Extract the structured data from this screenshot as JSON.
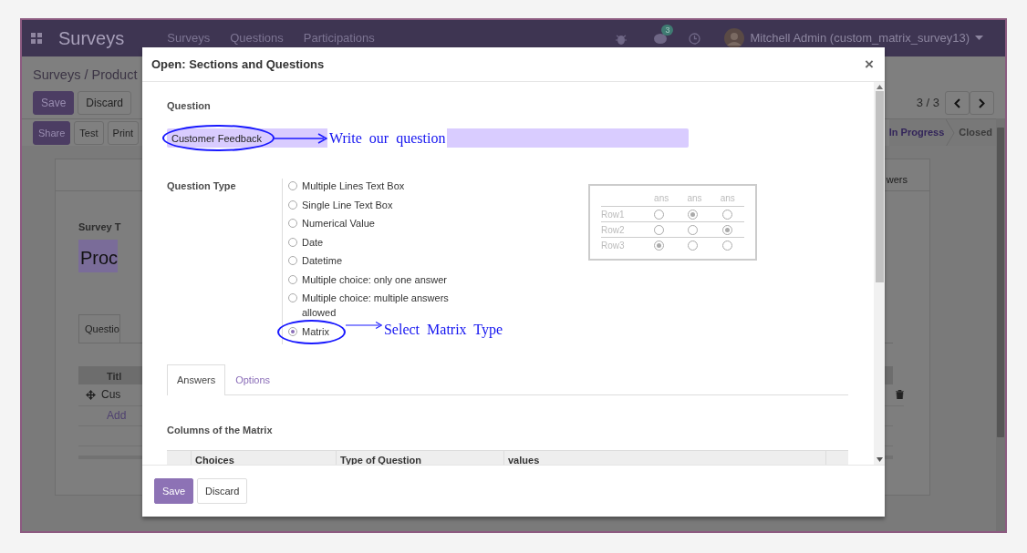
{
  "app": {
    "brand": "Surveys",
    "menu": [
      "Surveys",
      "Questions",
      "Participations"
    ],
    "badge": "3",
    "user": "Mitchell Admin (custom_matrix_survey13)"
  },
  "record": {
    "breadcrumb": "Surveys / Product",
    "buttons": [
      "Save",
      "Discard"
    ],
    "actions": [
      "Share",
      "Test",
      "Print"
    ],
    "pager": "3 / 3",
    "stages": [
      {
        "label": "In Progress",
        "selected": true
      },
      {
        "label": "Closed",
        "selected": false
      }
    ],
    "smart_button": "wers",
    "title_label": "Survey T",
    "title_value": "Proc",
    "tab": "Questio",
    "column": "Titl",
    "row": "Cus",
    "add_link": "Add"
  },
  "dialog": {
    "title": "Open: Sections and Questions",
    "close": "×",
    "question_label": "Question",
    "question_value": "Customer Feedback",
    "question_note": "Write our question",
    "type_label": "Question Type",
    "types": [
      {
        "label": "Multiple Lines Text Box",
        "selected": false
      },
      {
        "label": "Single Line Text Box",
        "selected": false
      },
      {
        "label": "Numerical Value",
        "selected": false
      },
      {
        "label": "Date",
        "selected": false
      },
      {
        "label": "Datetime",
        "selected": false
      },
      {
        "label": "Multiple choice: only one answer",
        "selected": false
      },
      {
        "label": "Multiple choice: multiple answers allowed",
        "selected": false
      },
      {
        "label": "Matrix",
        "selected": true,
        "note": "Select Matrix Type"
      }
    ],
    "preview": {
      "columns": [
        "ans",
        "ans",
        "ans"
      ],
      "rows": [
        {
          "label": "Row1",
          "checked": [
            false,
            true,
            false
          ]
        },
        {
          "label": "Row2",
          "checked": [
            false,
            false,
            true
          ]
        },
        {
          "label": "Row3",
          "checked": [
            true,
            false,
            false
          ]
        }
      ]
    },
    "tabs": [
      {
        "label": "Answers",
        "selected": true
      },
      {
        "label": "Options",
        "selected": false
      }
    ],
    "section": "Columns of the Matrix",
    "columns": [
      "Choices",
      "Type of Question",
      "values"
    ],
    "buttons": [
      "Save",
      "Discard"
    ]
  }
}
